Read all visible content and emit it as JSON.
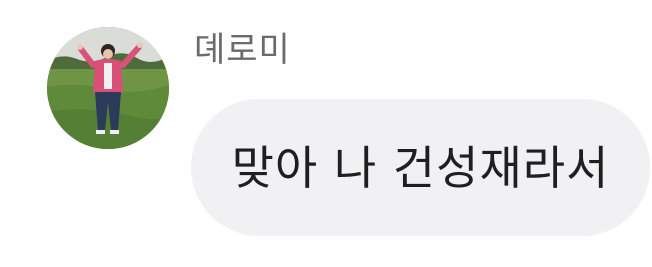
{
  "message": {
    "sender_name": "뎨로미",
    "text": "맞아 나 건성재라서",
    "avatar_icon": "profile-photo-person-in-field"
  },
  "colors": {
    "bubble_background": "#f1f1f4",
    "sender_name": "#6b6b6b",
    "message_text": "#1f1f1f"
  }
}
